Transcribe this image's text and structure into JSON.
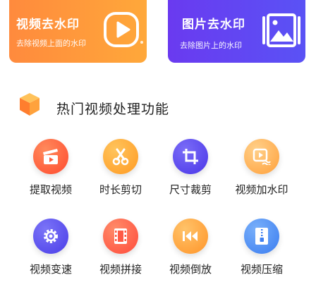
{
  "banners": [
    {
      "title": "视频去水印",
      "subtitle": "去除视频上面的水印",
      "icon": "play-icon",
      "color": "#ff9a3c"
    },
    {
      "title": "图片去水印",
      "subtitle": "去除图片上的水印",
      "icon": "image-icon",
      "color": "#6a46f2"
    }
  ],
  "section": {
    "title": "热门视频处理功能",
    "icon": "cube-icon"
  },
  "tools": [
    {
      "label": "提取视频",
      "icon": "clapperboard-icon",
      "color": "#ff5a3c"
    },
    {
      "label": "时长剪切",
      "icon": "scissors-icon",
      "color": "#ffa12e"
    },
    {
      "label": "尺寸裁剪",
      "icon": "crop-icon",
      "color": "#5b4af0"
    },
    {
      "label": "视频加水印",
      "icon": "video-watermark-icon",
      "color": "#ffae4a"
    },
    {
      "label": "视频变速",
      "icon": "gear-icon",
      "color": "#5a4ff0"
    },
    {
      "label": "视频拼接",
      "icon": "film-strip-icon",
      "color": "#ff6a4a"
    },
    {
      "label": "视频倒放",
      "icon": "rewind-icon",
      "color": "#ffa23a"
    },
    {
      "label": "视频压缩",
      "icon": "zip-file-icon",
      "color": "#4e8df5"
    }
  ]
}
